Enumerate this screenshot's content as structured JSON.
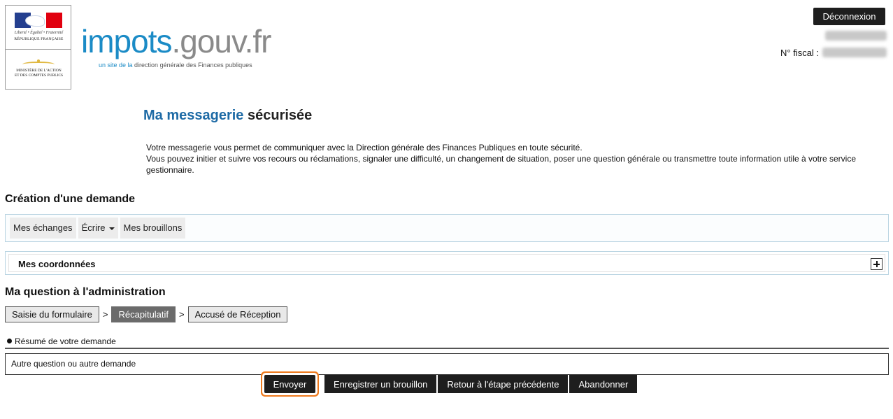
{
  "logo": {
    "motto": "Liberté • Égalité • Fraternité",
    "republic": "RÉPUBLIQUE FRANÇAISE",
    "ministry_line1": "MINISTÈRE DE L'ACTION",
    "ministry_line2": "ET DES COMPTES PUBLICS"
  },
  "brand": {
    "part1": "impots",
    "part2": ".gouv.fr",
    "tagline_prefix": "un site de la",
    "tagline_rest": " direction générale des Finances publiques"
  },
  "header": {
    "logout_label": "Déconnexion",
    "fiscal_label": "N° fiscal :"
  },
  "page": {
    "title_part1": "Ma messagerie",
    "title_part2": " sécurisée",
    "intro_line1": "Votre messagerie vous permet de communiquer avec la Direction générale des Finances Publiques en toute sécurité.",
    "intro_line2": "Vous pouvez initier et suivre vos recours ou réclamations, signaler une difficulté, un changement de situation, poser une question générale ou transmettre toute information utile à votre service gestionnaire."
  },
  "creation": {
    "heading": "Création d'une demande",
    "nav": [
      "Mes échanges",
      "Écrire",
      "Mes brouillons"
    ]
  },
  "coordinates": {
    "label": "Mes coordonnées"
  },
  "question": {
    "heading": "Ma question à l'administration",
    "steps": [
      "Saisie du formulaire",
      "Récapitulatif",
      "Accusé de Réception"
    ],
    "step_separator": ">",
    "active_step": "Récapitulatif",
    "summary_heading": "Résumé de votre demande",
    "summary_value": "Autre question ou autre demande"
  },
  "actions": {
    "send": "Envoyer",
    "save_draft": "Enregistrer un brouillon",
    "back": "Retour à l'étape précédente",
    "abandon": "Abandonner"
  },
  "colors": {
    "brand_blue": "#1b8bc6",
    "title_blue": "#1d6aa5",
    "focus_orange": "#ee7a1e",
    "button_dark": "#1e1e1e"
  }
}
